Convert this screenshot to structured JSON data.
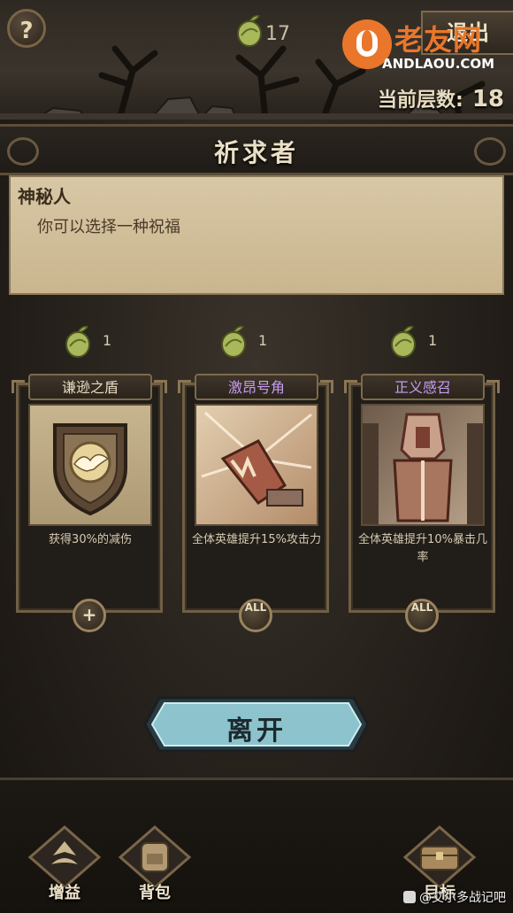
{
  "top_bar": {
    "help_label": "?",
    "seed_count": "17",
    "exit_label": "退出",
    "watermark_cn": "老友网",
    "watermark_en": "ANDLAOU.COM",
    "floor_label": "当前层数:",
    "floor_value": "18"
  },
  "event": {
    "title": "祈求者",
    "speaker": "神秘人",
    "message": "你可以选择一种祝福"
  },
  "cards": [
    {
      "cost": "1",
      "name": "谦逊之盾",
      "name_color": "#e6d9bd",
      "description": "获得30%的减伤",
      "badge": "+"
    },
    {
      "cost": "1",
      "name": "激昂号角",
      "name_color": "#c79cf0",
      "description": "全体英雄提升15%攻击力",
      "badge": "ALL"
    },
    {
      "cost": "1",
      "name": "正义感召",
      "name_color": "#c79cf0",
      "description": "全体英雄提升10%暴击几率",
      "badge": "ALL"
    }
  ],
  "leave_button": {
    "label": "离开"
  },
  "bottom_nav": [
    {
      "label": "增益",
      "icon": "buff-icon"
    },
    {
      "label": "背包",
      "icon": "backpack-icon"
    },
    {
      "label": "目标",
      "icon": "chest-icon"
    }
  ],
  "credit": "@艾尔多战记吧"
}
